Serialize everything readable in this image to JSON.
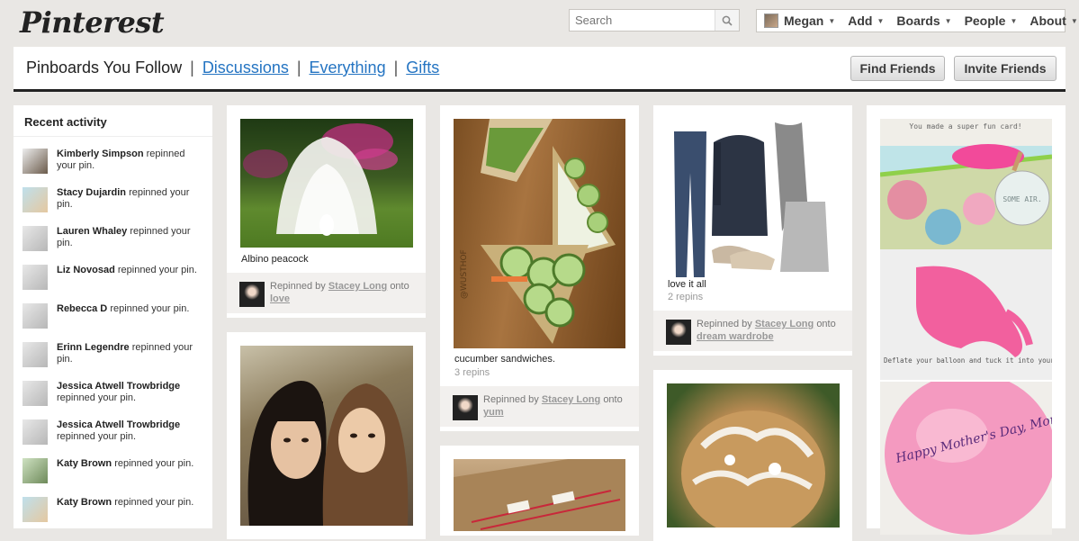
{
  "header": {
    "logo": "Pinterest",
    "search_placeholder": "Search",
    "nav": {
      "user": "Megan",
      "add": "Add",
      "boards": "Boards",
      "people": "People",
      "about": "About"
    }
  },
  "subnav": {
    "current": "Pinboards You Follow",
    "links": [
      "Discussions",
      "Everything",
      "Gifts"
    ],
    "separator": "|",
    "find_friends": "Find Friends",
    "invite_friends": "Invite Friends"
  },
  "recent": {
    "title": "Recent activity",
    "items": [
      {
        "name": "Kimberly Simpson",
        "action": "repinned your pin."
      },
      {
        "name": "Stacy Dujardin",
        "action": "repinned your pin."
      },
      {
        "name": "Lauren Whaley",
        "action": "repinned your pin."
      },
      {
        "name": "Liz Novosad",
        "action": "repinned your pin."
      },
      {
        "name": "Rebecca D",
        "action": "repinned your pin."
      },
      {
        "name": "Erinn Legendre",
        "action": "repinned your pin."
      },
      {
        "name": "Jessica Atwell Trowbridge",
        "action": "repinned your pin."
      },
      {
        "name": "Jessica Atwell Trowbridge",
        "action": "repinned your pin."
      },
      {
        "name": "Katy Brown",
        "action": "repinned your pin."
      },
      {
        "name": "Katy Brown",
        "action": "repinned your pin."
      }
    ]
  },
  "pins": {
    "peacock": {
      "caption": "Albino peacock",
      "repinned_by": "Repinned by",
      "user": "Stacey Long",
      "onto": "onto",
      "board": "love"
    },
    "sandwich": {
      "caption": "cucumber sandwiches.",
      "repins": "3 repins",
      "repinned_by": "Repinned by",
      "user": "Stacey Long",
      "onto": "onto",
      "board": "yum",
      "watermark": "@WUSTHOF"
    },
    "outfit": {
      "caption": "love it all",
      "repins": "2 repins",
      "repinned_by": "Repinned by",
      "user": "Stacey Long",
      "onto": "onto",
      "board": "dream wardrobe"
    },
    "balloon": {
      "top_text": "You made a super fun card!",
      "tag_text": "SOME AIR.",
      "mid_text": "Deflate your balloon and tuck it into your card pocket.",
      "bottom_text": "Happy Mother's Day, Mom! I Love You!"
    }
  }
}
